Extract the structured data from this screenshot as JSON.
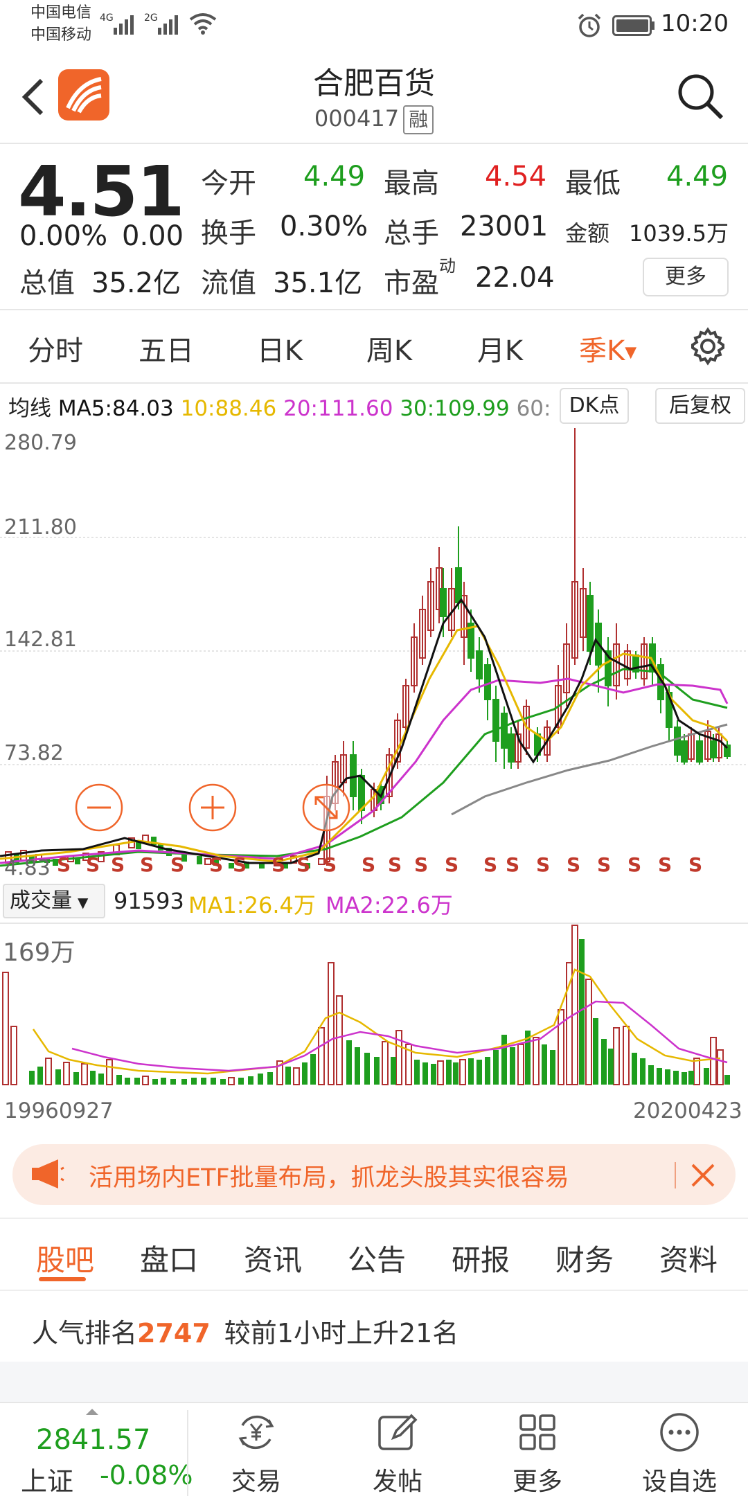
{
  "status_bar": {
    "carrier1": "中国电信",
    "carrier2": "中国移动",
    "net1": "4G",
    "net2": "2G",
    "time": "10:20"
  },
  "header": {
    "title": "合肥百货",
    "code": "000417",
    "badge": "融"
  },
  "quote": {
    "price": "4.51",
    "change_pct": "0.00%",
    "change": "0.00",
    "total_value_label": "总值",
    "total_value": "35.2亿",
    "open_label": "今开",
    "open": "4.49",
    "high_label": "最高",
    "high": "4.54",
    "low_label": "最低",
    "low": "4.49",
    "turnover_label": "换手",
    "turnover": "0.30%",
    "volume_label": "总手",
    "volume": "23001",
    "amount_label": "金额",
    "amount": "1039.5万",
    "float_value_label": "流值",
    "float_value": "35.1亿",
    "pe_label": "市盈",
    "pe_sup": "动",
    "pe": "22.04",
    "more": "更多"
  },
  "period_tabs": [
    "分时",
    "五日",
    "日K",
    "周K",
    "月K",
    "季K"
  ],
  "active_period": "季K",
  "ma_row": {
    "label": "均线",
    "ma5": "MA5:84.03",
    "ma10": "10:88.46",
    "ma20": "20:111.60",
    "ma30": "30:109.99",
    "ma60": "60:",
    "dk_button": "DK点",
    "adjust_button": "后复权"
  },
  "price_axis": [
    "280.79",
    "211.80",
    "142.81",
    "73.82",
    "4.83"
  ],
  "volume_header": {
    "selector": "成交量",
    "value": "91593",
    "ma1": "MA1:26.4万",
    "ma2": "MA2:22.6万",
    "axis_max": "169万"
  },
  "date_range": {
    "start": "19960927",
    "end": "20200423"
  },
  "banner": {
    "text": "活用场内ETF批量布局，抓龙头股其实很容易"
  },
  "info_tabs": [
    "股吧",
    "盘口",
    "资讯",
    "公告",
    "研报",
    "财务",
    "资料"
  ],
  "active_info_tab": "股吧",
  "popularity": {
    "prefix": "人气排名",
    "rank": "2747",
    "suffix": "较前1小时上升21名"
  },
  "bottom_bar": {
    "index_value": "2841.57",
    "index_name": "上证",
    "index_change": "-0.08%",
    "items": [
      "交易",
      "发帖",
      "更多",
      "设自选"
    ]
  },
  "colors": {
    "accent": "#f0652a",
    "up": "#e02020",
    "down": "#1e9e1e",
    "ma5": "#111111",
    "ma10": "#e6b800",
    "ma20": "#cc33cc",
    "ma30": "#1e9e1e",
    "ma60": "#888888"
  }
}
